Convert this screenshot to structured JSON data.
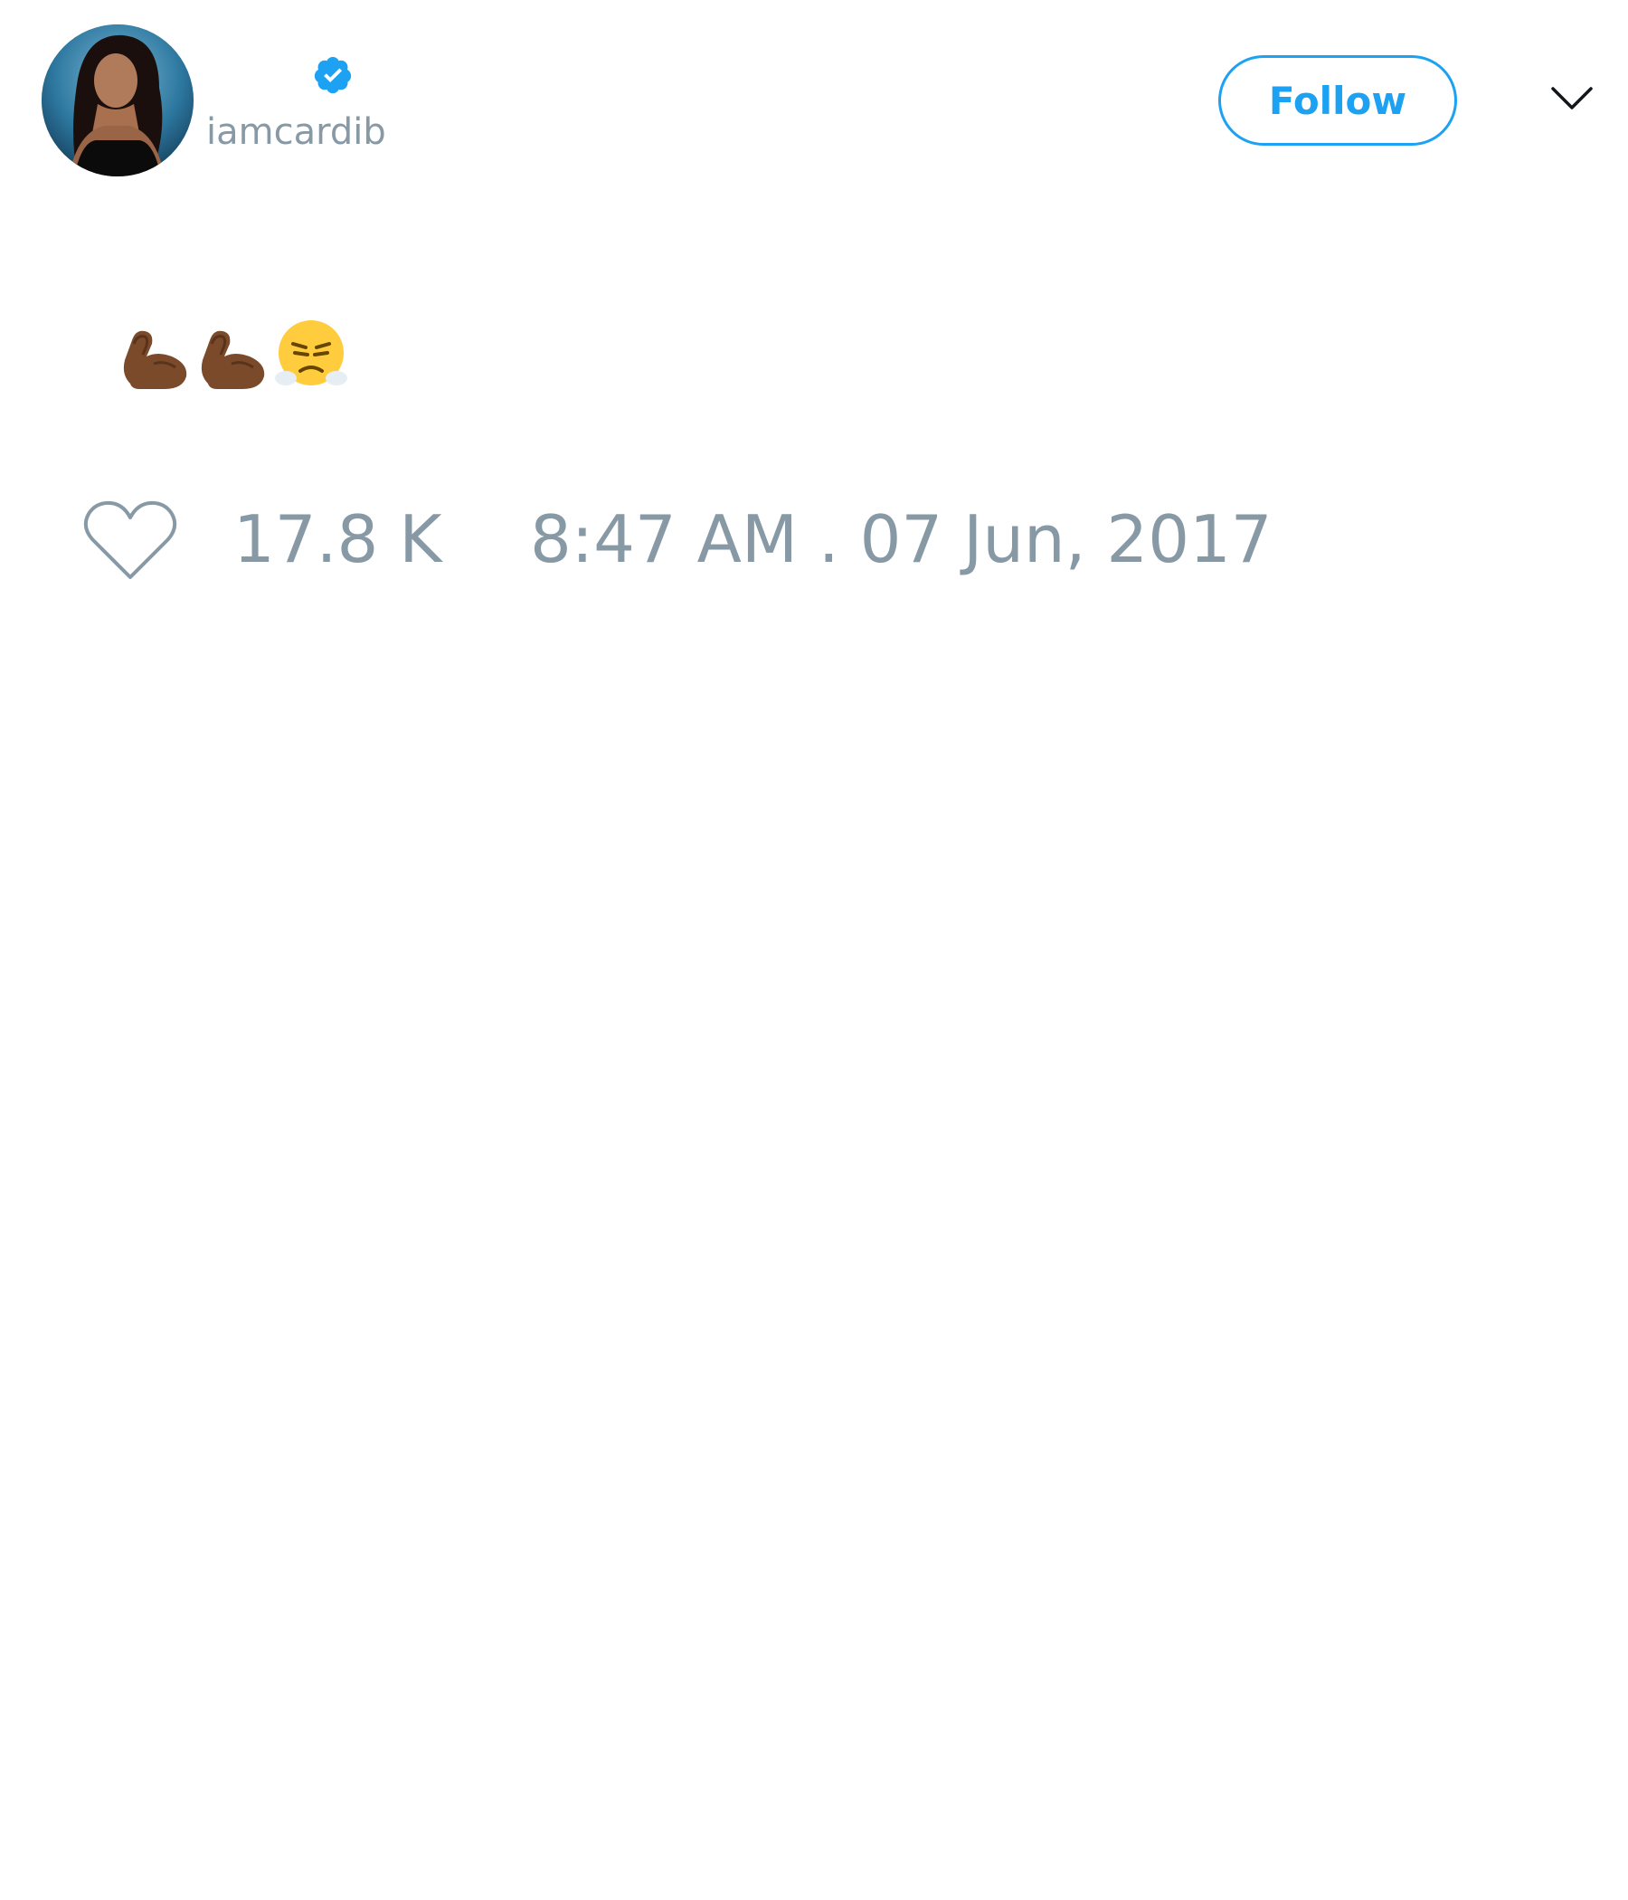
{
  "tweet": {
    "author": {
      "display_name": "",
      "handle": "iamcardib",
      "avatar_icon": "profile-photo",
      "verified": true,
      "verified_icon": "verified-badge-icon"
    },
    "follow_label": "Follow",
    "menu_icon": "chevron-down-icon",
    "text": "💪🏾💪🏾😤",
    "likes": "17.8 K",
    "like_icon": "heart-icon",
    "timestamp": "8:47 AM . 07 Jun, 2017"
  },
  "colors": {
    "accent": "#1da1f2",
    "muted_text": "#8899a6",
    "background": "#ffffff"
  }
}
